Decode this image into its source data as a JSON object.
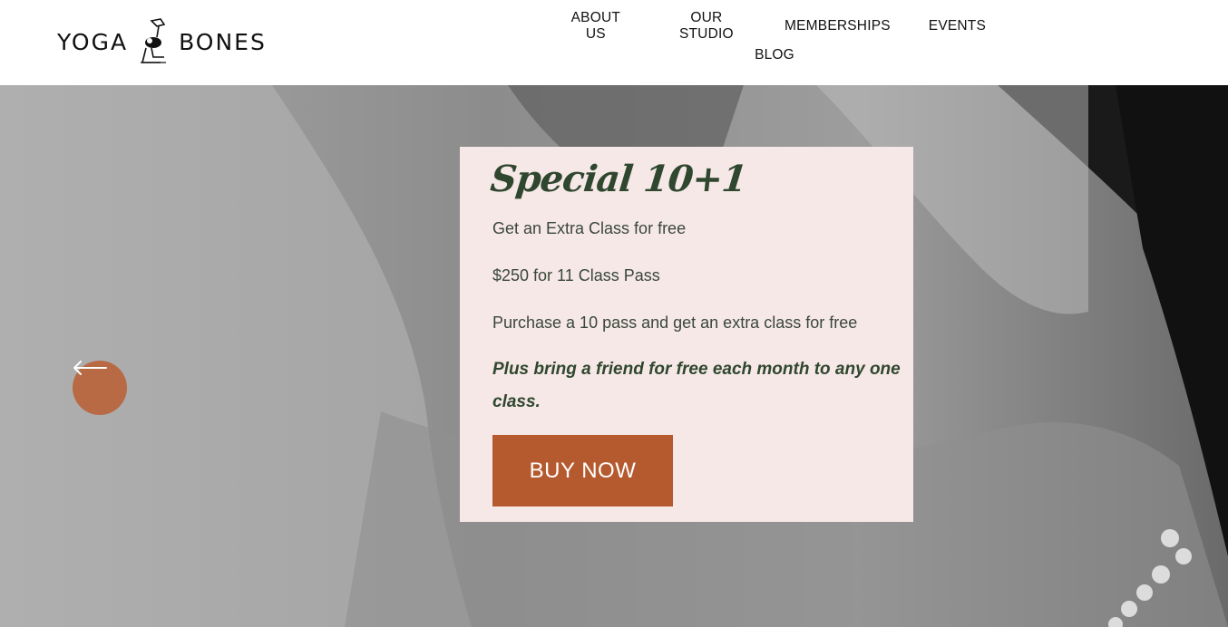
{
  "header": {
    "logo_left": "YOGA",
    "logo_right": "BONES",
    "nav": [
      {
        "label": "ABOUT US"
      },
      {
        "label": "OUR STUDIO"
      },
      {
        "label": "MEMBERSHIPS"
      },
      {
        "label": "EVENTS"
      },
      {
        "label": "BLOG"
      }
    ]
  },
  "hero": {
    "prev_icon": "arrow-left-icon",
    "promo": {
      "title": "Special 10+1",
      "line1": "Get an Extra Class for free",
      "line2": "$250 for 11 Class Pass",
      "line3": "Purchase a 10 pass and get an extra class for free",
      "highlight": "Plus bring a friend for free each month to any one class.",
      "button_label": "BUY NOW"
    }
  },
  "colors": {
    "accent": "#b5592f",
    "arrow_bg": "#b86a45",
    "promo_bg": "#f6e8e7",
    "text_green": "#30472f"
  }
}
